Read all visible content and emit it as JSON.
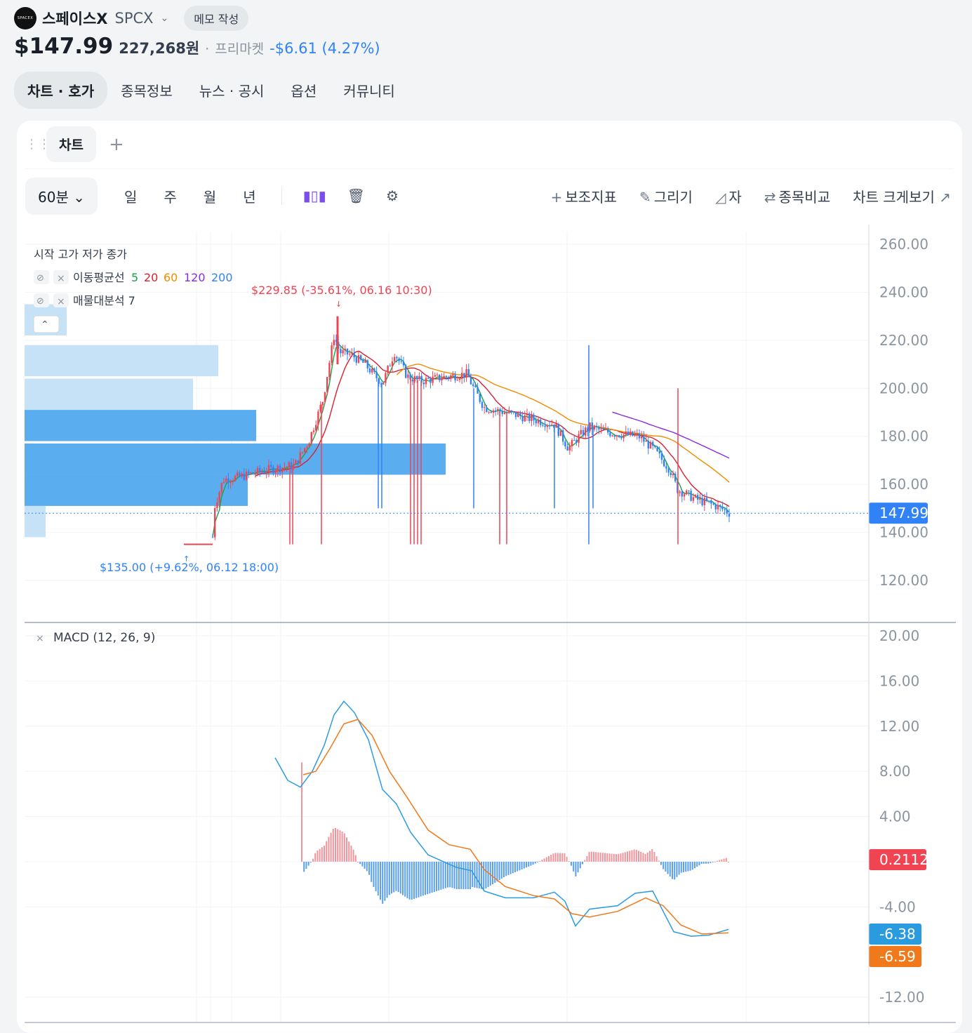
{
  "header": {
    "logo_text": "SPACEX",
    "name": "스페이스X",
    "ticker": "SPCX",
    "memo_label": "메모 작성"
  },
  "quote": {
    "price": "$147.99",
    "krw": "227,268원",
    "separator": "·",
    "market": "프리마켓",
    "change": "-$6.61 (4.27%)"
  },
  "tabs": [
    {
      "label": "차트 · 호가"
    },
    {
      "label": "종목정보"
    },
    {
      "label": "뉴스 · 공시"
    },
    {
      "label": "옵션"
    },
    {
      "label": "커뮤니티"
    }
  ],
  "chart_tab": {
    "label": "차트"
  },
  "toolbar": {
    "interval": "60분",
    "periods": [
      "일",
      "주",
      "월",
      "년"
    ],
    "indicators": "보조지표",
    "draw": "그리기",
    "ruler": "자",
    "compare": "종목비교",
    "fullscreen": "차트 크게보기"
  },
  "legend": {
    "ohlc": "시작 고가 저가 종가",
    "ma_label": "이동평균선",
    "ma_periods": [
      "5",
      "20",
      "60",
      "120",
      "200"
    ],
    "vp_label": "매물대분석 7"
  },
  "colors": {
    "up": "#f04452",
    "down": "#3182f6",
    "ma5": "#16a34a",
    "ma20": "#d6222f",
    "ma60": "#f08c00",
    "ma120": "#8a2be2",
    "macd_line": "#2b9be0",
    "signal": "#f07a1b"
  },
  "chart_data": [
    {
      "type": "candlestick",
      "y_ticks": [
        "260.00",
        "240.00",
        "220.00",
        "200.00",
        "180.00",
        "160.00",
        "140.00",
        "120.00"
      ],
      "ylim": [
        110,
        262
      ],
      "last_price": "147.99",
      "high_marker": "$229.85 (-35.61%, 06.16 10:30)",
      "low_marker": "$135.00 (+9.62%, 06.12 18:00)",
      "volume_profile": [
        {
          "range": [
            222,
            235
          ],
          "strength": 0.1
        },
        {
          "range": [
            205,
            218
          ],
          "strength": 0.46
        },
        {
          "range": [
            191,
            204
          ],
          "strength": 0.4
        },
        {
          "range": [
            178,
            191
          ],
          "strength": 0.55
        },
        {
          "range": [
            164,
            177
          ],
          "strength": 1.0
        },
        {
          "range": [
            151,
            164
          ],
          "strength": 0.53
        },
        {
          "range": [
            138,
            151
          ],
          "strength": 0.05
        }
      ],
      "ma_series": [
        {
          "name": "5"
        },
        {
          "name": "20"
        },
        {
          "name": "60"
        },
        {
          "name": "120"
        }
      ]
    },
    {
      "type": "line",
      "title": "MACD (12, 26, 9)",
      "y_ticks": [
        "20.00",
        "16.00",
        "12.00",
        "8.00",
        "4.00",
        "-4.00",
        "-12.00"
      ],
      "ylim": [
        -13,
        20.5
      ],
      "labels": {
        "histogram": "0.2112",
        "macd": "-6.38",
        "signal": "-6.59"
      }
    }
  ]
}
